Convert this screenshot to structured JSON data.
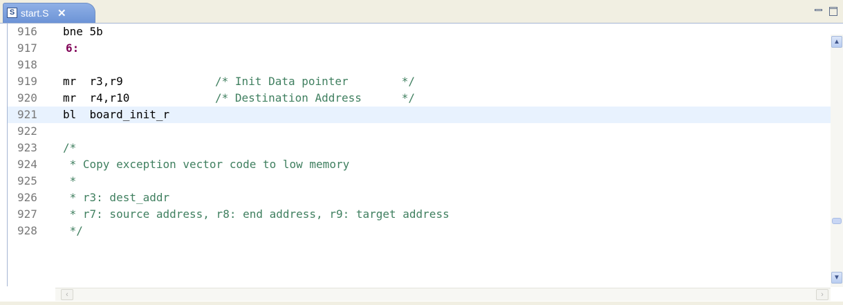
{
  "tab": {
    "icon_letter": "S",
    "title": "start.S",
    "close_glyph": "✕"
  },
  "window_controls": {
    "minimize": "minimize-icon",
    "maximize": "maximize-icon"
  },
  "colors": {
    "line_number": "#787878",
    "comment": "#3f7f5f",
    "label": "#7f0055",
    "current_line": "#e8f2fe",
    "tab": "#7aa1e0"
  },
  "lines": [
    {
      "num": "916",
      "code": "bne 5b"
    },
    {
      "num": "917",
      "label": "6:"
    },
    {
      "num": "918",
      "code": ""
    },
    {
      "num": "919",
      "code": "mr  r3,r9",
      "comment": "/* Init Data pointer        */"
    },
    {
      "num": "920",
      "code": "mr  r4,r10",
      "comment": "/* Destination Address      */"
    },
    {
      "num": "921",
      "code": "bl  board_init_r",
      "current": true
    },
    {
      "num": "922",
      "code": ""
    },
    {
      "num": "923",
      "comment_line": "/*"
    },
    {
      "num": "924",
      "comment_line": " * Copy exception vector code to low memory"
    },
    {
      "num": "925",
      "comment_line": " *"
    },
    {
      "num": "926",
      "comment_line": " * r3: dest_addr"
    },
    {
      "num": "927",
      "comment_line": " * r7: source address, r8: end address, r9: target address"
    },
    {
      "num": "928",
      "comment_line": " */"
    }
  ],
  "scrollbar": {
    "up_icon": "scroll-up-icon",
    "down_icon": "scroll-down-icon",
    "left_icon": "scroll-left-icon",
    "right_icon": "scroll-right-icon"
  }
}
